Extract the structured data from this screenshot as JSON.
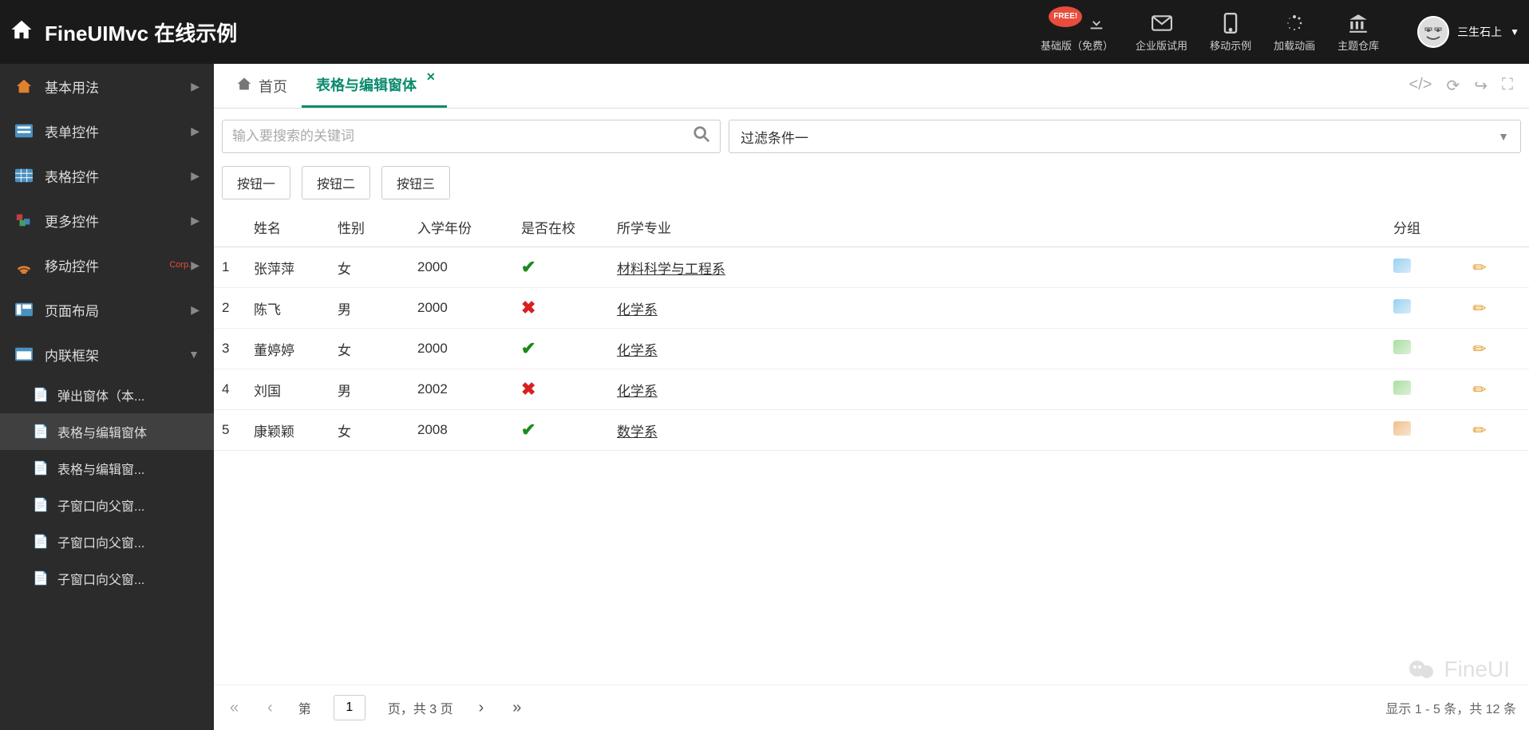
{
  "header": {
    "title": "FineUIMvc 在线示例",
    "nav": [
      {
        "label": "基础版（免费）",
        "badge": "FREE!"
      },
      {
        "label": "企业版试用"
      },
      {
        "label": "移动示例"
      },
      {
        "label": "加载动画"
      },
      {
        "label": "主题仓库"
      }
    ],
    "user": "三生石上"
  },
  "sidebar": {
    "items": [
      {
        "label": "基本用法",
        "expanded": false
      },
      {
        "label": "表单控件",
        "expanded": false
      },
      {
        "label": "表格控件",
        "expanded": false
      },
      {
        "label": "更多控件",
        "expanded": false
      },
      {
        "label": "移动控件",
        "expanded": false,
        "corp": "Corp."
      },
      {
        "label": "页面布局",
        "expanded": false
      },
      {
        "label": "内联框架",
        "expanded": true,
        "children": [
          {
            "label": "弹出窗体（本..."
          },
          {
            "label": "表格与编辑窗体",
            "active": true
          },
          {
            "label": "表格与编辑窗..."
          },
          {
            "label": "子窗口向父窗..."
          },
          {
            "label": "子窗口向父窗..."
          },
          {
            "label": "子窗口向父窗..."
          }
        ]
      }
    ]
  },
  "tabs": {
    "home": "首页",
    "active": "表格与编辑窗体"
  },
  "search": {
    "placeholder": "输入要搜索的关键词",
    "filter": "过滤条件一"
  },
  "buttons": {
    "b1": "按钮一",
    "b2": "按钮二",
    "b3": "按钮三"
  },
  "table": {
    "headers": {
      "name": "姓名",
      "gender": "性别",
      "year": "入学年份",
      "oncampus": "是否在校",
      "major": "所学专业",
      "group": "分组"
    },
    "rows": [
      {
        "idx": "1",
        "name": "张萍萍",
        "gender": "女",
        "year": "2000",
        "on": true,
        "major": "材料科学与工程系",
        "tag": "blue"
      },
      {
        "idx": "2",
        "name": "陈飞",
        "gender": "男",
        "year": "2000",
        "on": false,
        "major": "化学系",
        "tag": "blue"
      },
      {
        "idx": "3",
        "name": "董婷婷",
        "gender": "女",
        "year": "2000",
        "on": true,
        "major": "化学系",
        "tag": "green"
      },
      {
        "idx": "4",
        "name": "刘国",
        "gender": "男",
        "year": "2002",
        "on": false,
        "major": "化学系",
        "tag": "green"
      },
      {
        "idx": "5",
        "name": "康颖颖",
        "gender": "女",
        "year": "2008",
        "on": true,
        "major": "数学系",
        "tag": "orange"
      }
    ]
  },
  "pager": {
    "prefix": "第",
    "current": "1",
    "suffix": "页，共 3 页",
    "summary": "显示 1 - 5 条，共 12 条"
  },
  "watermark": "FineUI"
}
